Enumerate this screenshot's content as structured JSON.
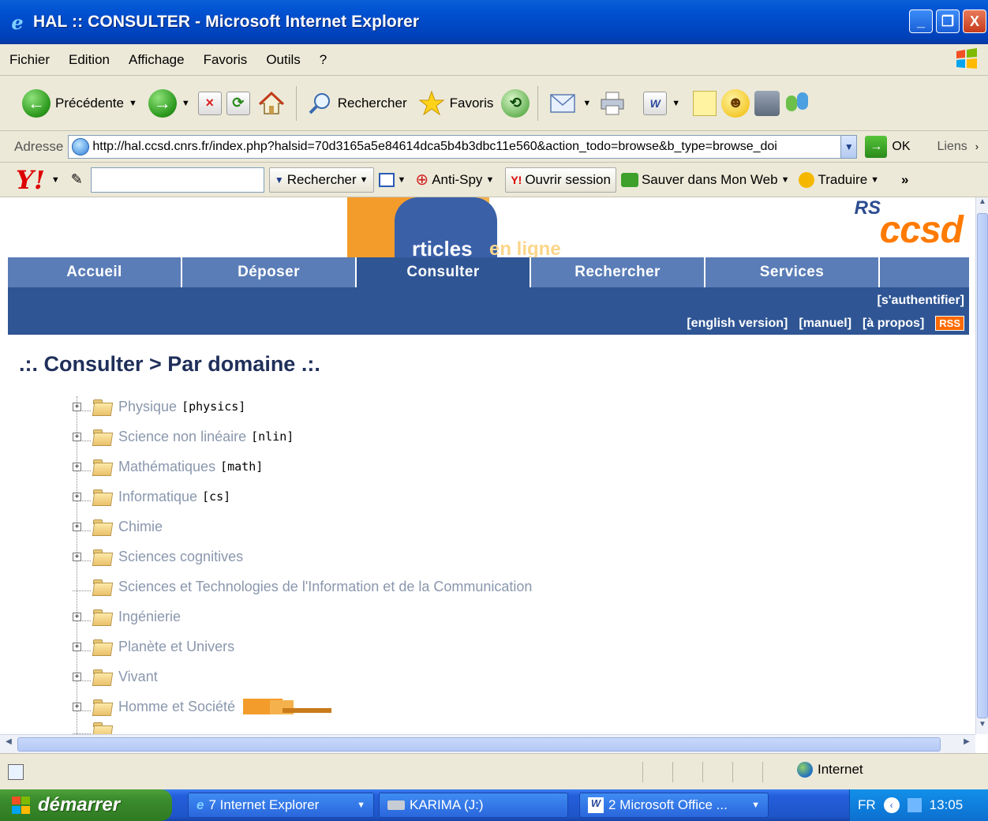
{
  "window": {
    "title": "HAL :: CONSULTER - Microsoft Internet Explorer",
    "buttons": [
      "_",
      "❐",
      "X"
    ]
  },
  "menu": [
    "Fichier",
    "Edition",
    "Affichage",
    "Favoris",
    "Outils",
    "?"
  ],
  "toolbar": {
    "back_label": "Précédente",
    "search_label": "Rechercher",
    "favorites_label": "Favoris"
  },
  "address": {
    "label": "Adresse",
    "url": "http://hal.ccsd.cnrs.fr/index.php?halsid=70d3165a5e84614dca5b4b3dbc11e560&action_todo=browse&b_type=browse_doi",
    "go_label": "OK",
    "links_label": "Liens"
  },
  "yahoo": {
    "search_value": "",
    "search_label": "Rechercher",
    "antispy_label": "Anti-Spy",
    "session_label": "Ouvrir session",
    "save_label": "Sauver dans Mon Web",
    "translate_label": "Traduire"
  },
  "site": {
    "logo_tagline_a": "rticles",
    "logo_tagline_b": "en ligne",
    "partner_logo": "ccsd",
    "partner_logo_small": "RS",
    "nav": [
      "Accueil",
      "Déposer",
      "Consulter",
      "Rechercher",
      "Services"
    ],
    "nav_active": "Consulter",
    "auth_link": "[s'authentifier]",
    "english_link": "[english version]",
    "manual_link": "[manuel]",
    "about_link": "[à propos]",
    "rss_badge": "RSS",
    "page_title": ".:. Consulter > Par domaine .:."
  },
  "domains": [
    {
      "name": "Physique",
      "code": "[physics]",
      "expandable": true
    },
    {
      "name": "Science non linéaire",
      "code": "[nlin]",
      "expandable": true
    },
    {
      "name": "Mathématiques",
      "code": "[math]",
      "expandable": true
    },
    {
      "name": "Informatique",
      "code": "[cs]",
      "expandable": true
    },
    {
      "name": "Chimie",
      "code": "",
      "expandable": true
    },
    {
      "name": "Sciences cognitives",
      "code": "",
      "expandable": true
    },
    {
      "name": "Sciences et Technologies de l'Information et de la Communication",
      "code": "",
      "expandable": false
    },
    {
      "name": "Ingénierie",
      "code": "",
      "expandable": true
    },
    {
      "name": "Planète et Univers",
      "code": "",
      "expandable": true
    },
    {
      "name": "Vivant",
      "code": "",
      "expandable": true
    },
    {
      "name": "Homme et Société",
      "code": "",
      "expandable": true
    }
  ],
  "status": {
    "zone_label": "Internet"
  },
  "taskbar": {
    "start_label": "démarrer",
    "tasks": [
      "7 Internet Explorer",
      "KARIMA (J:)",
      "2 Microsoft Office ..."
    ],
    "lang": "FR",
    "clock": "13:05"
  },
  "icons": {
    "back": "back-arrow-icon",
    "forward": "forward-arrow-icon",
    "stop": "stop-icon",
    "refresh": "refresh-icon",
    "home": "home-icon",
    "search": "search-icon",
    "favorites": "star-icon",
    "history": "history-icon",
    "mail": "mail-icon",
    "print": "print-icon",
    "edit": "word-icon",
    "folder": "folder-icon"
  },
  "colors": {
    "nav_bg": "#5a7db7",
    "nav_active": "#2f5594",
    "title_color": "#1f2f5a",
    "tree_text": "#8a97ad",
    "hal_orange": "#f39c2c"
  }
}
